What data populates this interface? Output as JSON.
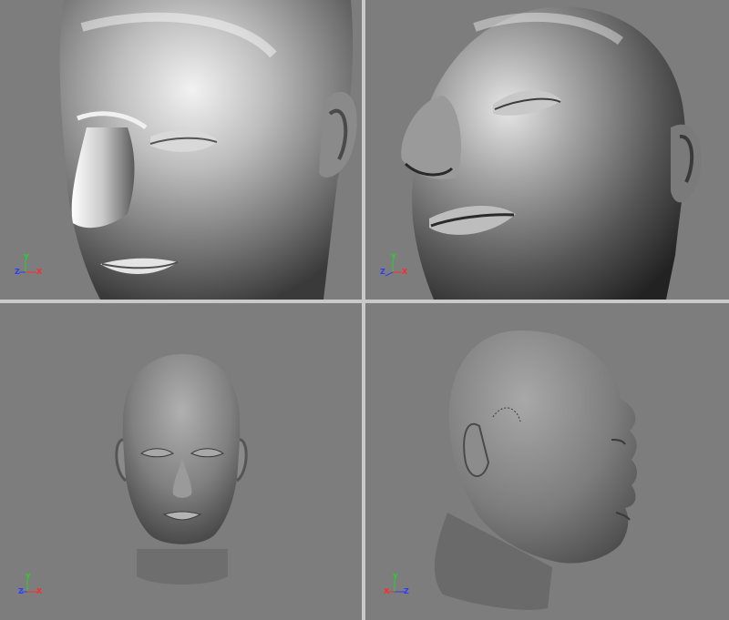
{
  "viewports": [
    {
      "id": "perspective-closeup-left",
      "axes": {
        "y": "Y",
        "z": "Z",
        "x": "X"
      }
    },
    {
      "id": "perspective-low-angle",
      "axes": {
        "y": "Y",
        "z": "Z",
        "x": "X"
      }
    },
    {
      "id": "front-view",
      "axes": {
        "y": "Y",
        "z": "Z",
        "x": "X"
      }
    },
    {
      "id": "side-view",
      "axes": {
        "y": "Y",
        "x": "X",
        "z": "Z"
      }
    }
  ],
  "colors": {
    "viewport_bg": "#7d7d7d",
    "separator": "#c9c9c9",
    "axis_x": "#ff2a2a",
    "axis_y": "#22d322",
    "axis_z": "#2c3cff"
  }
}
